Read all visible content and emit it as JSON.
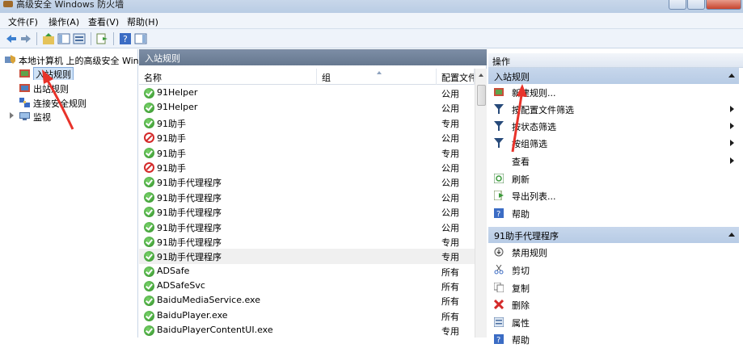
{
  "window": {
    "title": "高级安全 Windows 防火墙"
  },
  "menu": {
    "items": [
      "文件(F)",
      "操作(A)",
      "查看(V)",
      "帮助(H)"
    ]
  },
  "tree": {
    "root": "本地计算机 上的高级安全 Wind",
    "items": [
      "入站规则",
      "出站规则",
      "连接安全规则",
      "监视"
    ]
  },
  "center": {
    "header": "入站规则",
    "columns": {
      "name": "名称",
      "group": "组",
      "profile": "配置文件"
    },
    "rows": [
      {
        "name": "91Helper",
        "profile": "公用",
        "status": "allow"
      },
      {
        "name": "91Helper",
        "profile": "公用",
        "status": "allow"
      },
      {
        "name": "91助手",
        "profile": "专用",
        "status": "allow"
      },
      {
        "name": "91助手",
        "profile": "公用",
        "status": "block"
      },
      {
        "name": "91助手",
        "profile": "专用",
        "status": "allow"
      },
      {
        "name": "91助手",
        "profile": "公用",
        "status": "block"
      },
      {
        "name": "91助手代理程序",
        "profile": "公用",
        "status": "allow"
      },
      {
        "name": "91助手代理程序",
        "profile": "公用",
        "status": "allow"
      },
      {
        "name": "91助手代理程序",
        "profile": "公用",
        "status": "allow"
      },
      {
        "name": "91助手代理程序",
        "profile": "公用",
        "status": "allow"
      },
      {
        "name": "91助手代理程序",
        "profile": "专用",
        "status": "allow"
      },
      {
        "name": "91助手代理程序",
        "profile": "专用",
        "status": "allow"
      },
      {
        "name": "ADSafe",
        "profile": "所有",
        "status": "allow"
      },
      {
        "name": "ADSafeSvc",
        "profile": "所有",
        "status": "allow"
      },
      {
        "name": "BaiduMediaService.exe",
        "profile": "所有",
        "status": "allow"
      },
      {
        "name": "BaiduPlayer.exe",
        "profile": "所有",
        "status": "allow"
      },
      {
        "name": "BaiduPlayerContentUI.exe",
        "profile": "专用",
        "status": "allow"
      }
    ]
  },
  "actions": {
    "header": "操作",
    "section1": {
      "title": "入站规则",
      "items": [
        "新建规则...",
        "按配置文件筛选",
        "按状态筛选",
        "按组筛选",
        "查看",
        "刷新",
        "导出列表...",
        "帮助"
      ]
    },
    "section2": {
      "title": "91助手代理程序",
      "items": [
        "禁用规则",
        "剪切",
        "复制",
        "删除",
        "属性",
        "帮助"
      ]
    }
  },
  "colors": {
    "allow": "#2e8d26",
    "block": "#d42a2a",
    "annotation_arrow": "#e8332a",
    "section_header": "#b7cbe5"
  }
}
